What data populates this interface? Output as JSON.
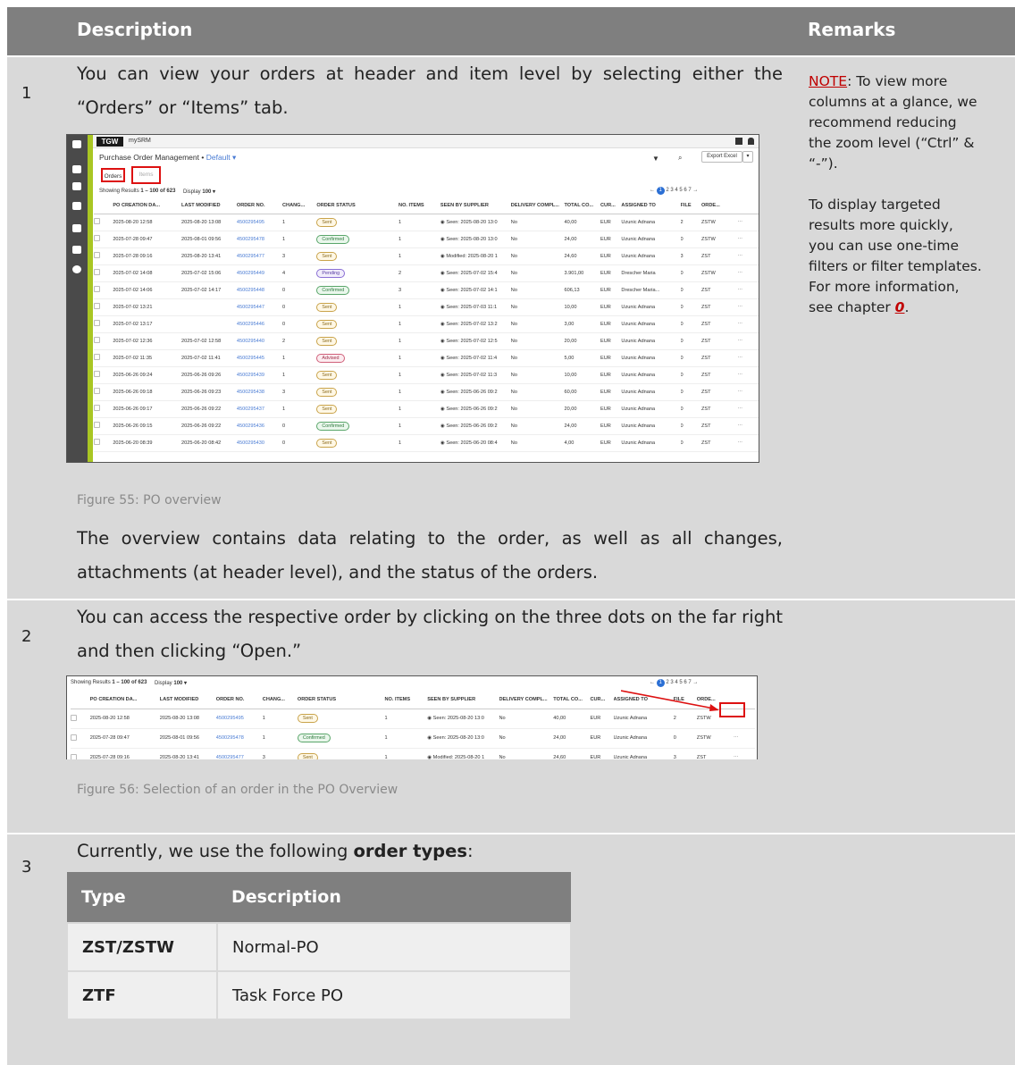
{
  "header": {
    "col_description": "Description",
    "col_remarks": "Remarks"
  },
  "rows": [
    {
      "number": "1",
      "text_a": "You can view your orders at header and item level by selecting either the “Orders” or “Items” tab.",
      "caption": "Figure 55: PO overview",
      "text_b": "The overview contains data relating to the order, as well as all changes, attachments (at header level), and the status of the orders.",
      "remark": {
        "note": "NOTE",
        "p1": ": To view more columns at a glance, we recommend reducing the zoom level (“Ctrl” & “-”).",
        "p2": "To display targeted results more quickly, you can use one-time filters or filter templates. For more information, see chapter ",
        "ref": "0",
        "p2_end": "."
      }
    },
    {
      "number": "2",
      "text": "You can access the respective order by clicking on the three dots on the far right and then clicking “Open.”",
      "caption": "Figure 56: Selection of an order in the PO Overview"
    },
    {
      "number": "3",
      "text_pre": "Currently, we use the following ",
      "text_bold": "order types",
      "text_post": ":",
      "types_table": {
        "headers": [
          "Type",
          "Description"
        ],
        "rows": [
          [
            "ZST/ZSTW",
            "Normal-PO"
          ],
          [
            "ZTF",
            "Task Force PO"
          ]
        ]
      }
    }
  ],
  "screenshot1": {
    "logo": "TGW",
    "app_name": "mySRM",
    "page_title": "Purchase Order Management",
    "bullet": "•",
    "view_name": "Default ▾",
    "tab_orders": "Orders",
    "tab_items": "Items",
    "results_prefix": "Showing Results",
    "results_range": "1 – 100 of 623",
    "display_label": "Display",
    "display_value": "100 ▾",
    "export_label": "Export Excel",
    "pager_current": "1",
    "pager_rest": "2  3  4  5  6  7  →",
    "pager_prev": "←",
    "sidebar_icons": [
      "home-icon",
      "list-icon",
      "document-icon",
      "user-icon",
      "truck-icon",
      "tool-icon",
      "gear-icon"
    ]
  },
  "screenshot2": {
    "results_prefix": "Showing Results",
    "results_range": "1 – 100 of 623",
    "display_label": "Display",
    "display_value": "100 ▾",
    "pager_current": "1",
    "pager_rest": "2  3  4  5  6  7  →",
    "pager_prev": "←"
  },
  "po_table": {
    "columns": [
      "PO CREATION DA...",
      "LAST MODIFIED",
      "ORDER NO.",
      "CHANG...",
      "ORDER STATUS",
      "NO. ITEMS",
      "SEEN BY SUPPLIER",
      "DELIVERY COMPL...",
      "TOTAL CO...",
      "CUR...",
      "ASSIGNED TO",
      "FILE",
      "ORDE..."
    ],
    "rows": [
      [
        "2025-08-20 12:58",
        "2025-08-20 13:08",
        "4500295495",
        "1",
        "Sent",
        "1",
        "◉ Seen: 2025-08-20 13:0",
        "No",
        "40,00",
        "EUR",
        "Uzunic Adnana",
        "2",
        "ZSTW",
        "sent"
      ],
      [
        "2025-07-28 09:47",
        "2025-08-01 09:56",
        "4500295478",
        "1",
        "Confirmed",
        "1",
        "◉ Seen: 2025-08-20 13:0",
        "No",
        "24,00",
        "EUR",
        "Uzunic Adnana",
        "0",
        "ZSTW",
        "conf"
      ],
      [
        "2025-07-28 09:16",
        "2025-08-20 13:41",
        "4500295477",
        "3",
        "Sent",
        "1",
        "◉ Modified: 2025-08-20 1",
        "No",
        "24,60",
        "EUR",
        "Uzunic Adnana",
        "3",
        "ZST",
        "sent"
      ],
      [
        "2025-07-02 14:08",
        "2025-07-02 15:06",
        "4500295449",
        "4",
        "Pending",
        "2",
        "◉ Seen: 2025-07-02 15:4",
        "No",
        "3.901,00",
        "EUR",
        "Drescher Maria",
        "0",
        "ZSTW",
        "pend"
      ],
      [
        "2025-07-02 14:06",
        "2025-07-02 14:17",
        "4500295448",
        "0",
        "Confirmed",
        "3",
        "◉ Seen: 2025-07-02 14:1",
        "No",
        "606,13",
        "EUR",
        "Drescher Maria...",
        "0",
        "ZST",
        "conf"
      ],
      [
        "2025-07-02 13:21",
        "",
        "4500295447",
        "0",
        "Sent",
        "1",
        "◉ Seen: 2025-07-03 11:1",
        "No",
        "10,00",
        "EUR",
        "Uzunic Adnana",
        "0",
        "ZST",
        "sent"
      ],
      [
        "2025-07-02 13:17",
        "",
        "4500295446",
        "0",
        "Sent",
        "1",
        "◉ Seen: 2025-07-02 13:2",
        "No",
        "3,00",
        "EUR",
        "Uzunic Adnana",
        "0",
        "ZST",
        "sent"
      ],
      [
        "2025-07-02 12:36",
        "2025-07-02 12:58",
        "4500295440",
        "2",
        "Sent",
        "1",
        "◉ Seen: 2025-07-02 12:5",
        "No",
        "20,00",
        "EUR",
        "Uzunic Adnana",
        "0",
        "ZST",
        "sent"
      ],
      [
        "2025-07-02 11:35",
        "2025-07-02 11:41",
        "4500295445",
        "1",
        "Advised",
        "1",
        "◉ Seen: 2025-07-02 11:4",
        "No",
        "5,00",
        "EUR",
        "Uzunic Adnana",
        "0",
        "ZST",
        "adv"
      ],
      [
        "2025-06-26 09:24",
        "2025-06-26 09:26",
        "4500295439",
        "1",
        "Sent",
        "1",
        "◉ Seen: 2025-07-02 11:3",
        "No",
        "10,00",
        "EUR",
        "Uzunic Adnana",
        "0",
        "ZST",
        "sent"
      ],
      [
        "2025-06-26 09:18",
        "2025-06-26 09:23",
        "4500295438",
        "3",
        "Sent",
        "1",
        "◉ Seen: 2025-06-26 09:2",
        "No",
        "60,00",
        "EUR",
        "Uzunic Adnana",
        "0",
        "ZST",
        "sent"
      ],
      [
        "2025-06-26 09:17",
        "2025-06-26 09:22",
        "4500295437",
        "1",
        "Sent",
        "1",
        "◉ Seen: 2025-06-26 09:2",
        "No",
        "20,00",
        "EUR",
        "Uzunic Adnana",
        "0",
        "ZST",
        "sent"
      ],
      [
        "2025-06-26 09:15",
        "2025-06-26 09:22",
        "4500295436",
        "0",
        "Confirmed",
        "1",
        "◉ Seen: 2025-06-26 09:2",
        "No",
        "24,00",
        "EUR",
        "Uzunic Adnana",
        "0",
        "ZST",
        "conf"
      ],
      [
        "2025-06-20 08:39",
        "2025-06-20 08:42",
        "4500295430",
        "0",
        "Sent",
        "1",
        "◉ Seen: 2025-06-20 08:4",
        "No",
        "4,00",
        "EUR",
        "Uzunic Adnana",
        "0",
        "ZST",
        "sent"
      ]
    ],
    "more_icon": "⋯"
  },
  "colors": {
    "header_gray": "#7f7f7f",
    "row_gray": "#d9d9d9",
    "accent_red": "#c00000",
    "sidebar_green": "#a9c623",
    "link_blue": "#4a7cd4"
  }
}
